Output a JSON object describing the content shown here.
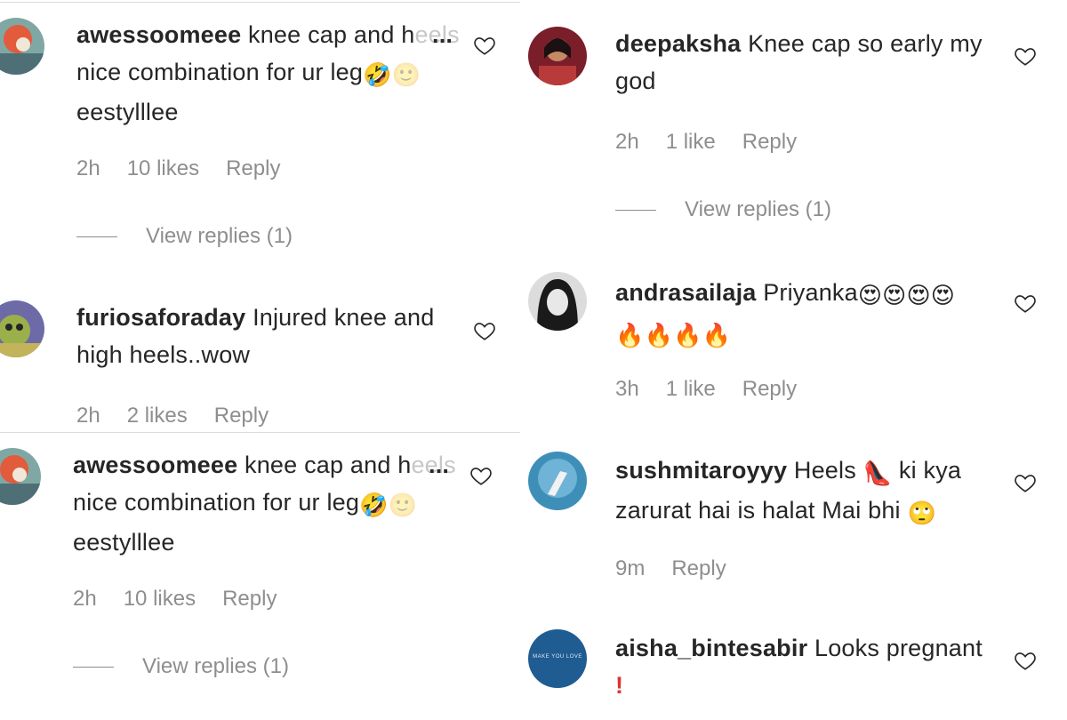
{
  "comments_left": [
    {
      "username": "awessoomeee",
      "text_main": "knee cap and h",
      "text_fade": "eels",
      "line2": "nice combination for ur leg",
      "line3": "eestylllee",
      "time": "2h",
      "likes": "10 likes",
      "reply_label": "Reply",
      "view_replies": "View replies (1)"
    },
    {
      "username": "furiosaforaday",
      "text_main": "Injured knee and",
      "line2": "high heels..wow",
      "time": "2h",
      "likes": "2 likes",
      "reply_label": "Reply"
    },
    {
      "username": "awessoomeee",
      "text_main": "knee cap and h",
      "text_fade": "eels",
      "line2": "nice combination for ur leg",
      "line3": "eestylllee",
      "time": "2h",
      "likes": "10 likes",
      "reply_label": "Reply",
      "view_replies": "View replies (1)"
    }
  ],
  "comments_right": [
    {
      "username": "deepaksha",
      "text_main": "Knee cap so early my",
      "line2": "god",
      "time": "2h",
      "likes": "1 like",
      "reply_label": "Reply",
      "view_replies": "View replies (1)"
    },
    {
      "username": "andrasailaja",
      "text_main": "Priyanka",
      "time": "3h",
      "likes": "1 like",
      "reply_label": "Reply"
    },
    {
      "username": "sushmitaroyyy",
      "text_main": "Heels",
      "text_after": "ki kya",
      "line2": "zarurat hai is halat Mai bhi",
      "time": "9m",
      "reply_label": "Reply"
    },
    {
      "username": "aisha_bintesabir",
      "text_main": "Looks pregnant",
      "line2": "!",
      "avatar_text": "MAKE YOU LOVE"
    }
  ],
  "ellipsis": "...",
  "icons": {
    "heart": "heart-outline-icon",
    "laugh": "rolling-laughing-emoji",
    "heart_eyes": "heart-eyes-emoji",
    "fire": "fire-emoji",
    "heel": "high-heel-emoji",
    "eye_roll": "eye-roll-emoji"
  }
}
